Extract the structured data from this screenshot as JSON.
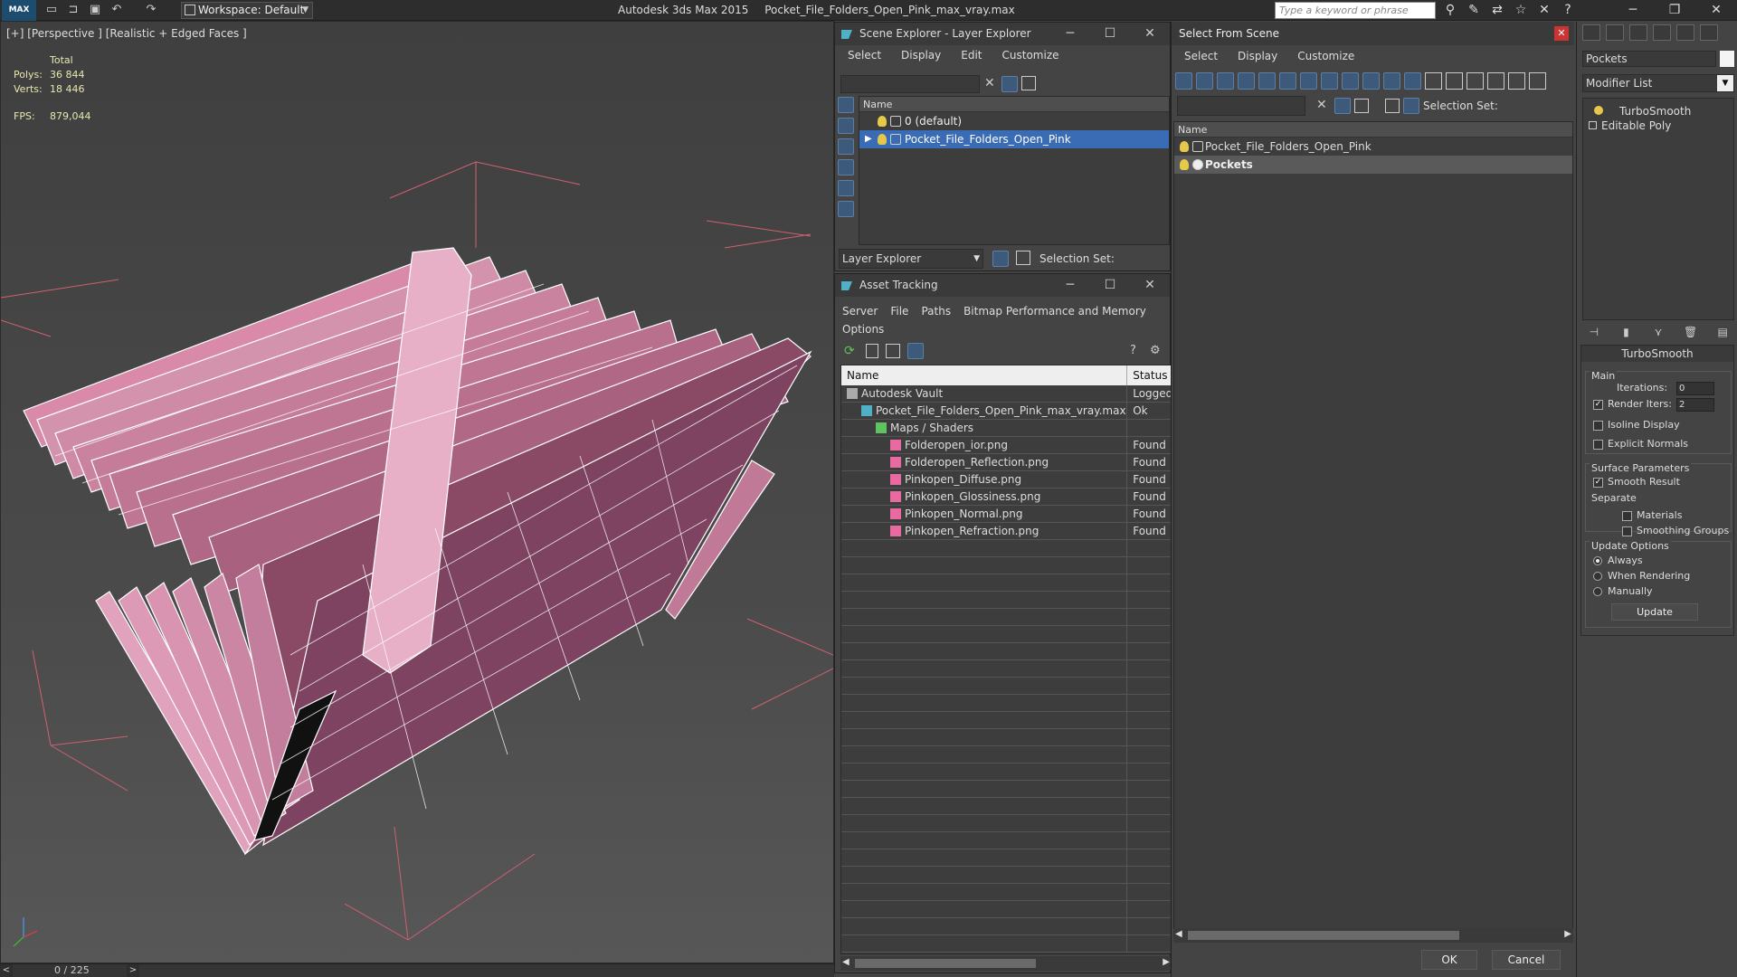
{
  "app": {
    "logo": "MAX",
    "workspace": "Workspace: Default",
    "title_app": "Autodesk 3ds Max  2015",
    "title_file": "Pocket_File_Folders_Open_Pink_max_vray.max",
    "search_placeholder": "Type a keyword or phrase"
  },
  "viewport": {
    "label": "[+] [Perspective ] [Realistic + Edged Faces ]",
    "stats": {
      "total_label": "Total",
      "polys_label": "Polys:",
      "polys_value": "36 844",
      "verts_label": "Verts:",
      "verts_value": "18 446",
      "fps_label": "FPS:",
      "fps_value": "879,044"
    }
  },
  "timeline": {
    "frame": "0 / 225",
    "prev": "<",
    "next": ">"
  },
  "scene_explorer": {
    "title": "Scene Explorer - Layer Explorer",
    "menu": [
      "Select",
      "Display",
      "Edit",
      "Customize"
    ],
    "column": "Name",
    "rows": [
      "0 (default)",
      "Pocket_File_Folders_Open_Pink"
    ],
    "dropdown": "Layer Explorer",
    "selection_set_label": "Selection Set:"
  },
  "asset_tracking": {
    "title": "Asset Tracking",
    "menu": [
      "Server",
      "File",
      "Paths",
      "Bitmap Performance and Memory"
    ],
    "menu2": "Options",
    "col_name": "Name",
    "col_status": "Status",
    "rows": [
      {
        "name": "Autodesk Vault",
        "status": "Logged",
        "indent": 0
      },
      {
        "name": "Pocket_File_Folders_Open_Pink_max_vray.max",
        "status": "Ok",
        "indent": 1
      },
      {
        "name": "Maps / Shaders",
        "status": "",
        "indent": 2
      },
      {
        "name": "Folderopen_ior.png",
        "status": "Found",
        "indent": 3
      },
      {
        "name": "Folderopen_Reflection.png",
        "status": "Found",
        "indent": 3
      },
      {
        "name": "Pinkopen_Diffuse.png",
        "status": "Found",
        "indent": 3
      },
      {
        "name": "Pinkopen_Glossiness.png",
        "status": "Found",
        "indent": 3
      },
      {
        "name": "Pinkopen_Normal.png",
        "status": "Found",
        "indent": 3
      },
      {
        "name": "Pinkopen_Refraction.png",
        "status": "Found",
        "indent": 3
      }
    ]
  },
  "select_from_scene": {
    "title": "Select From Scene",
    "menu": [
      "Select",
      "Display",
      "Customize"
    ],
    "selection_set_label": "Selection Set:",
    "column": "Name",
    "rows": [
      "Pocket_File_Folders_Open_Pink",
      "Pockets"
    ],
    "ok": "OK",
    "cancel": "Cancel"
  },
  "command_panel": {
    "object_name": "Pockets",
    "modifier_list": "Modifier List",
    "stack": [
      "TurboSmooth",
      "Editable Poly"
    ],
    "rollout_title": "TurboSmooth",
    "main_label": "Main",
    "iterations_label": "Iterations:",
    "iterations_value": "0",
    "render_iters_label": "Render Iters:",
    "render_iters_value": "2",
    "isoline_label": "Isoline Display",
    "explicit_label": "Explicit Normals",
    "surface_label": "Surface Parameters",
    "smooth_label": "Smooth Result",
    "separate_label": "Separate",
    "materials_label": "Materials",
    "smoothing_label": "Smoothing Groups",
    "update_options_label": "Update Options",
    "always_label": "Always",
    "when_rendering_label": "When Rendering",
    "manually_label": "Manually",
    "update_button": "Update"
  }
}
